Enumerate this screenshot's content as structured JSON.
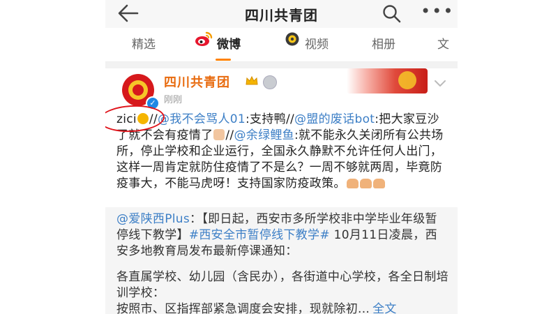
{
  "header": {
    "title": "四川共青团",
    "back_icon": "arrow-left-icon",
    "search_icon": "search-icon",
    "more_label": "•••"
  },
  "tabs": [
    {
      "label": "精选",
      "icon": ""
    },
    {
      "label": "微博",
      "icon": "weibo-icon",
      "active": true
    },
    {
      "label": "视频",
      "icon": "video-icon"
    },
    {
      "label": "相册",
      "icon": ""
    },
    {
      "label": "文",
      "icon": ""
    }
  ],
  "post": {
    "author": "四川共青团",
    "time": "刚刚",
    "verified_mark": "✓",
    "text": {
      "t1": "zici",
      "t2": "//",
      "m1": "@我不会骂人01",
      "t3": ":支持鸭//",
      "m2": "@盟的废话bot",
      "t4": ":把大家豆沙了就不会有疫情了",
      "t5": "//",
      "m3": "@余绿鲤鱼",
      "t6": ":就不能永久关闭所有公共场所，停止学校和企业运行，全国永久静默不允许任何人出门，这样一周肯定就防住疫情了不是么？一周不够就两周，毕竟防疫事大，不能马虎呀！支持国家防疫政策。"
    }
  },
  "repost": {
    "m1": "@爱陕西Plus",
    "t1": "：【即日起，西安市多所学校非中学毕业年级暂停线下教学】",
    "tag": "#西安全市暂停线下教学#",
    "t2": " 10月11日凌晨，西安多地教育局发布最新停课通知：",
    "p2": "各直属学校、幼儿园（含民办），各街道中心学校，各全日制培训学校：",
    "p3": "按照市、区指挥部紧急调度会安排，现就除初...",
    "full": "全文"
  },
  "colors": {
    "accent_orange": "#ff8200",
    "link_blue": "#3d7fc6",
    "author_orange": "#e86b0f",
    "annotation_red": "#e0141b"
  }
}
